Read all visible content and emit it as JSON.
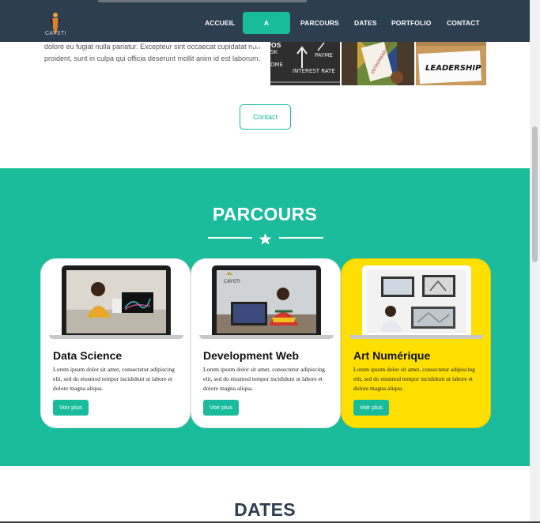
{
  "nav": {
    "logo_text": "CAYSTI",
    "items": [
      {
        "label": "ACCUEIL",
        "active": false
      },
      {
        "label": "A PROPOS",
        "active": true
      },
      {
        "label": "PARCOURS",
        "active": false
      },
      {
        "label": "DATES",
        "active": false
      },
      {
        "label": "PORTFOLIO",
        "active": false
      },
      {
        "label": "CONTACT",
        "active": false
      }
    ]
  },
  "about": {
    "text": "dolore eu fugiat nulla pariatur. Excepteur sint occaecat cupidatat non proident, sunt in culpa qui officia deserunt mollit anim id est laborum.",
    "images": [
      {
        "caption_main": "INTEREST RATE",
        "caption_side": "PAYME",
        "caption_left": "SK",
        "caption_left2": "OME"
      },
      {
        "caption": "ENTREPRENEURSHIP"
      },
      {
        "caption": "LEADERSHIP"
      }
    ],
    "contact_button": "Contact"
  },
  "parcours": {
    "title": "PARCOURS",
    "cards": [
      {
        "title": "Data Science",
        "text": "Lorem ipsum dolor sit amet, consectetur adipiscing elit, sed do eiusmod tempor incididunt ut labore et dolore magna aliqua.",
        "button": "Voir plus",
        "highlight": false
      },
      {
        "title": "Development Web",
        "text": "Lorem ipsum dolor sit amet, consectetur adipiscing elit, sed do eiusmod tempor incididunt ut labore et dolore magna aliqua.",
        "button": "Voir plus",
        "highlight": false,
        "screen_logo": "CAYSTI"
      },
      {
        "title": "Art Numérique",
        "text": "Lorem ipsum dolor sit amet, consectetur adipiscing elit, sed do eiusmod tempor incididunt ut labore et dolore magna aliqua.",
        "button": "Voir plus",
        "highlight": true
      }
    ]
  },
  "dates": {
    "title": "DATES"
  },
  "colors": {
    "navbar": "#2c3e50",
    "accent": "#18bc9c",
    "section_bg": "#1abc9c",
    "highlight_card": "#ffdf00"
  },
  "icons": {
    "divider": "star-icon"
  }
}
